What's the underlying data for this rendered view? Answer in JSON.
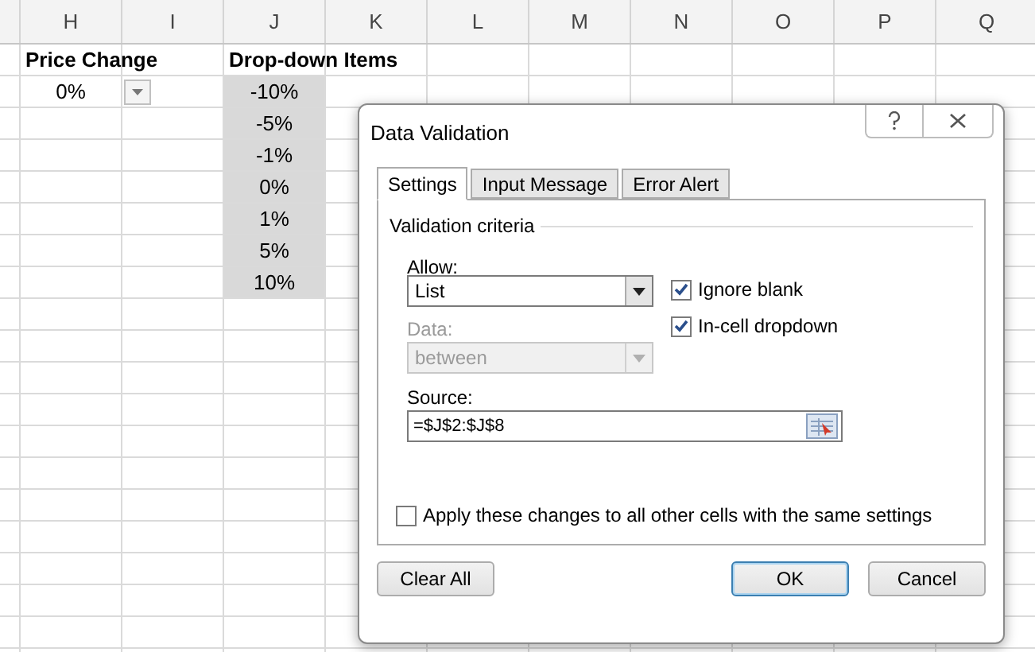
{
  "spreadsheet": {
    "columns": [
      "H",
      "I",
      "J",
      "K",
      "L",
      "M",
      "N",
      "O",
      "P",
      "Q"
    ],
    "rows": [
      {
        "cells": [
          {
            "kind": "heading",
            "text": "Price Change"
          },
          {
            "kind": "empty"
          },
          {
            "kind": "heading",
            "text": "Drop-down Items"
          }
        ]
      },
      {
        "cells": [
          {
            "kind": "value",
            "text": "0%"
          },
          {
            "kind": "dropdown_button"
          },
          {
            "kind": "list_item",
            "text": "-10%"
          }
        ]
      },
      {
        "cells": [
          {
            "kind": "empty"
          },
          {
            "kind": "empty"
          },
          {
            "kind": "list_item",
            "text": "-5%"
          }
        ]
      },
      {
        "cells": [
          {
            "kind": "empty"
          },
          {
            "kind": "empty"
          },
          {
            "kind": "list_item",
            "text": "-1%"
          }
        ]
      },
      {
        "cells": [
          {
            "kind": "empty"
          },
          {
            "kind": "empty"
          },
          {
            "kind": "list_item",
            "text": "0%"
          }
        ]
      },
      {
        "cells": [
          {
            "kind": "empty"
          },
          {
            "kind": "empty"
          },
          {
            "kind": "list_item",
            "text": "1%"
          }
        ]
      },
      {
        "cells": [
          {
            "kind": "empty"
          },
          {
            "kind": "empty"
          },
          {
            "kind": "list_item",
            "text": "5%"
          }
        ]
      },
      {
        "cells": [
          {
            "kind": "empty"
          },
          {
            "kind": "empty"
          },
          {
            "kind": "list_item",
            "text": "10%"
          }
        ]
      }
    ]
  },
  "dialog": {
    "title": "Data Validation",
    "tabs": [
      {
        "label": "Settings",
        "selected": true
      },
      {
        "label": "Input Message",
        "selected": false
      },
      {
        "label": "Error Alert",
        "selected": false
      }
    ],
    "section_title": "Validation criteria",
    "allow": {
      "label": "Allow:",
      "value": "List",
      "disabled": false
    },
    "data": {
      "label": "Data:",
      "value": "between",
      "disabled": true
    },
    "checkboxes": [
      {
        "label": "Ignore blank",
        "checked": true
      },
      {
        "label": "In-cell dropdown",
        "checked": true
      }
    ],
    "source": {
      "label": "Source:",
      "value": "=$J$2:$J$8"
    },
    "apply_all": {
      "label": "Apply these changes to all other cells with the same settings",
      "checked": false
    },
    "buttons": [
      {
        "label": "Clear All",
        "default": false
      },
      {
        "label": "OK",
        "default": true
      },
      {
        "label": "Cancel",
        "default": false
      }
    ]
  }
}
